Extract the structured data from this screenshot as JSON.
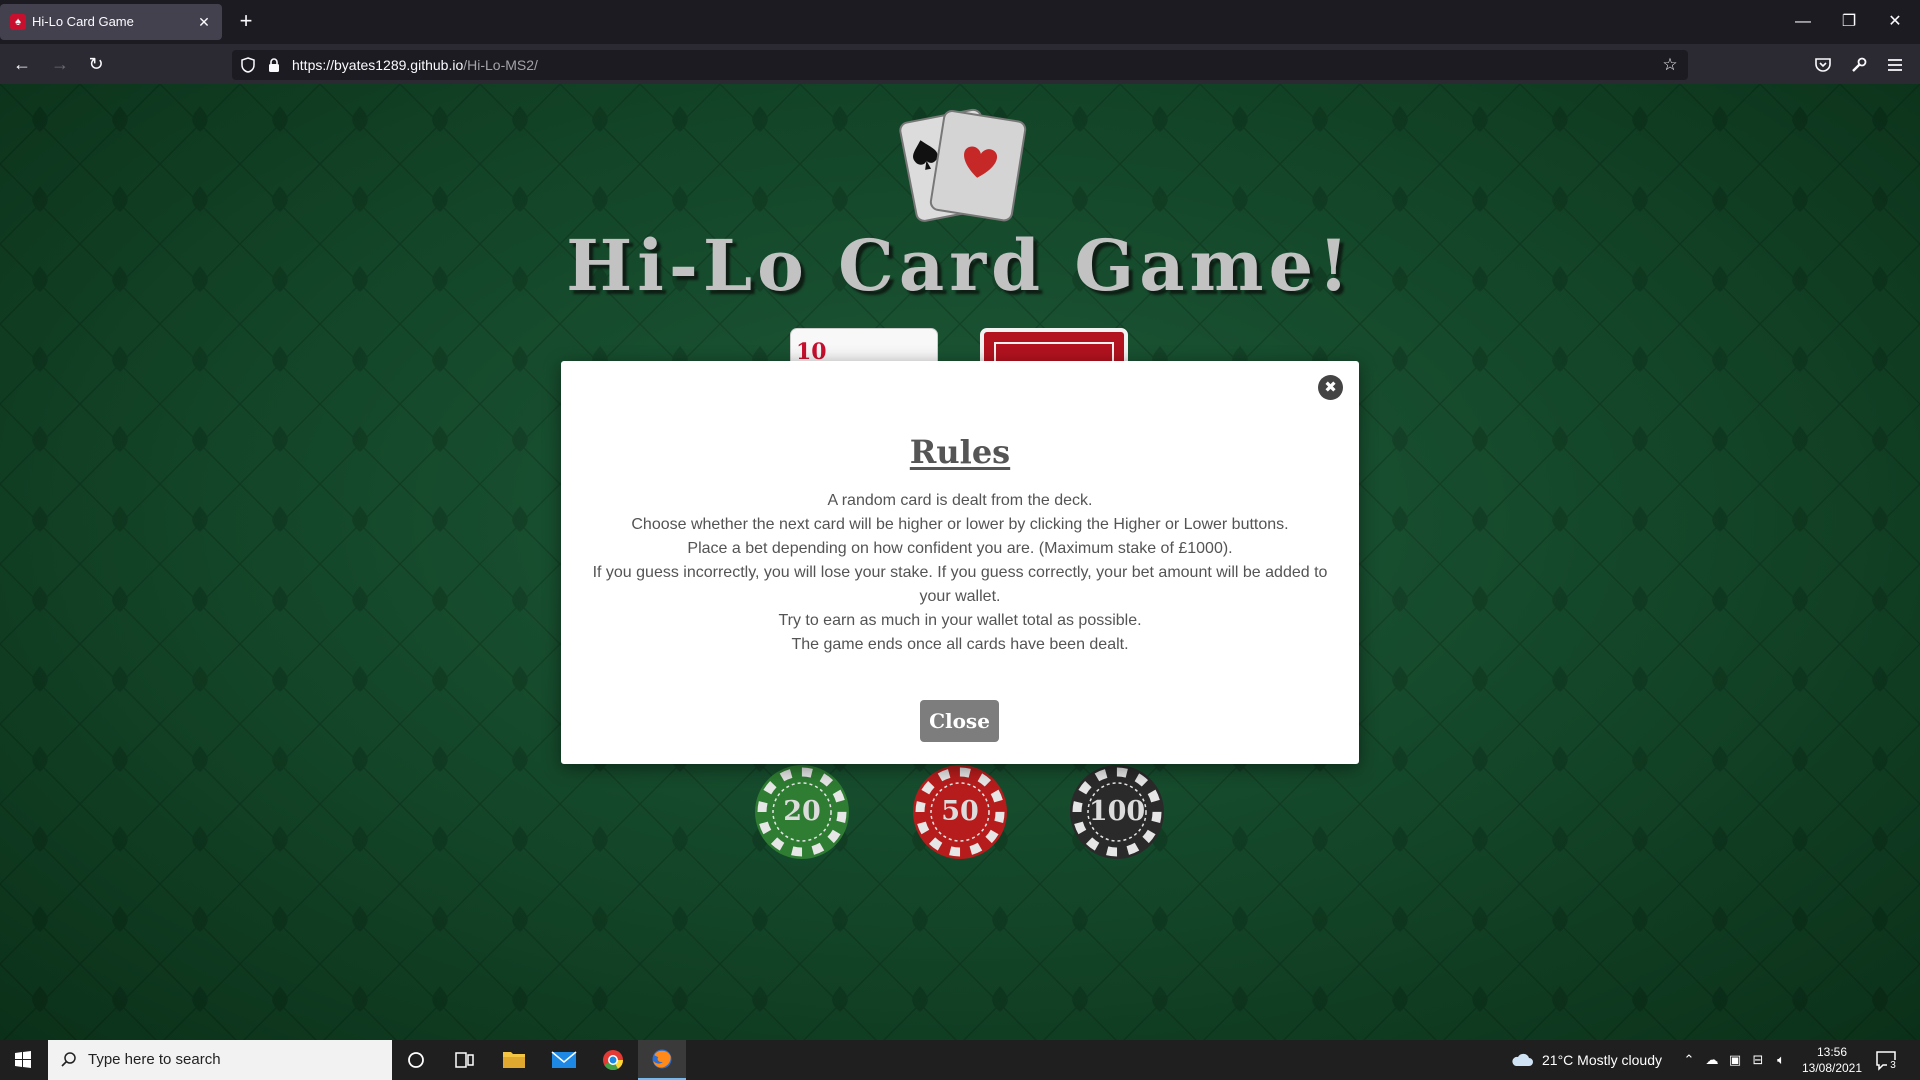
{
  "browser": {
    "tab_title": "Hi-Lo Card Game",
    "url_domain": "https://byates1289.github.io",
    "url_path": "/Hi-Lo-MS2/"
  },
  "page": {
    "title": "Hi-Lo Card Game!",
    "current_card_rank": "10",
    "chips": [
      {
        "value": "20",
        "color": "#2e7d32"
      },
      {
        "value": "50",
        "color": "#b71c1c"
      },
      {
        "value": "100",
        "color": "#2a2a2a"
      }
    ]
  },
  "modal": {
    "heading": "Rules",
    "rules": [
      "A random card is dealt from the deck.",
      "Choose whether the next card will be higher or lower by clicking the Higher or Lower buttons.",
      "Place a bet depending on how confident you are. (Maximum stake of £1000).",
      "If you guess incorrectly, you will lose your stake. If you guess correctly, your bet amount will be added to your wallet.",
      "Try to earn as much in your wallet total as possible.",
      "The game ends once all cards have been dealt."
    ],
    "close_label": "Close",
    "close_x": "✖"
  },
  "taskbar": {
    "search_placeholder": "Type here to search",
    "weather": "21°C  Mostly cloudy",
    "time": "13:56",
    "date": "13/08/2021",
    "notification_count": "3"
  },
  "colors": {
    "felt": "#134528",
    "modal_button": "#7d7d7d",
    "card_back": "#b3121f"
  }
}
